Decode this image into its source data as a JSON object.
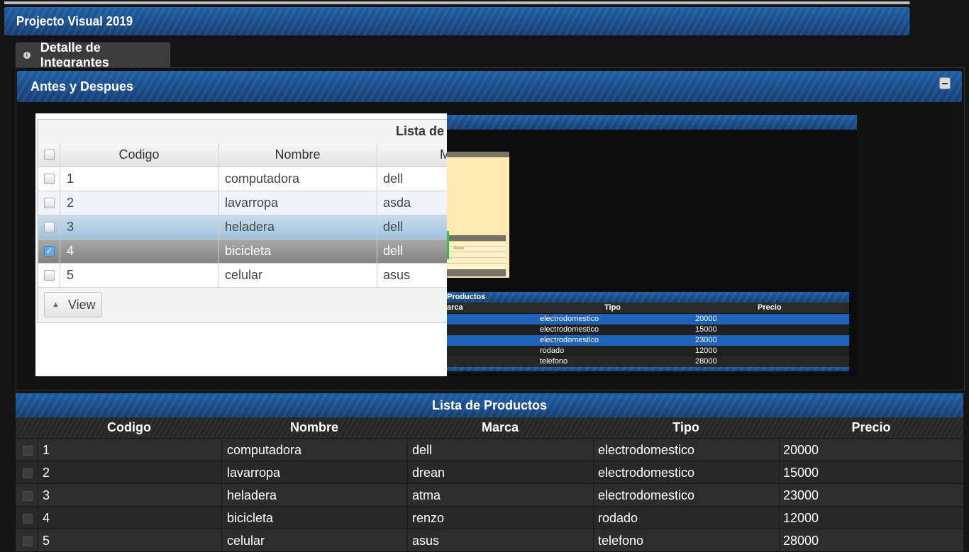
{
  "header": {
    "title": "Projecto Visual 2019"
  },
  "tab": {
    "label": "Detalle de Integrantes"
  },
  "panel": {
    "title": "Antes y Despues"
  },
  "before_screenshot": {
    "caption": "Lista de P",
    "columns": [
      "Codigo",
      "Nombre",
      "M"
    ],
    "rows": [
      {
        "codigo": "1",
        "nombre": "computadora",
        "marca": "dell",
        "checked": false
      },
      {
        "codigo": "2",
        "nombre": "lavarropa",
        "marca": "asda",
        "checked": false
      },
      {
        "codigo": "3",
        "nombre": "heladera",
        "marca": "dell",
        "checked": false
      },
      {
        "codigo": "4",
        "nombre": "bicicleta",
        "marca": "dell",
        "checked": true
      },
      {
        "codigo": "5",
        "nombre": "celular",
        "marca": "asus",
        "checked": false
      }
    ],
    "view_button": "View"
  },
  "after_screenshot": {
    "caption": "Productos",
    "columns": [
      "arca",
      "Tipo",
      "Precio"
    ],
    "popup_label": "Precio",
    "rows": [
      {
        "tipo": "electrodomestico",
        "precio": "20000"
      },
      {
        "tipo": "electrodomestico",
        "precio": "15000"
      },
      {
        "tipo": "electrodomestico",
        "precio": "23000"
      },
      {
        "tipo": "rodado",
        "precio": "12000"
      },
      {
        "tipo": "telefono",
        "precio": "28000"
      }
    ]
  },
  "productos": {
    "title": "Lista de Productos",
    "columns": [
      "Codigo",
      "Nombre",
      "Marca",
      "Tipo",
      "Precio"
    ],
    "rows": [
      {
        "codigo": "1",
        "nombre": "computadora",
        "marca": "dell",
        "tipo": "electrodomestico",
        "precio": "20000"
      },
      {
        "codigo": "2",
        "nombre": "lavarropa",
        "marca": "drean",
        "tipo": "electrodomestico",
        "precio": "15000"
      },
      {
        "codigo": "3",
        "nombre": "heladera",
        "marca": "atma",
        "tipo": "electrodomestico",
        "precio": "23000"
      },
      {
        "codigo": "4",
        "nombre": "bicicleta",
        "marca": "renzo",
        "tipo": "rodado",
        "precio": "12000"
      },
      {
        "codigo": "5",
        "nombre": "celular",
        "marca": "asus",
        "tipo": "telefono",
        "precio": "28000"
      }
    ]
  },
  "colors": {
    "header_blue": "#1e5ea3",
    "selected_row_light": "#a9cbe2",
    "checked_row": "#8f8f8f",
    "mini_selected_row": "#1f63b8"
  },
  "icons": {
    "tab_icon": "info-icon",
    "panel_toggle": "collapse-icon",
    "view_toggle": "chevron-up-icon"
  }
}
